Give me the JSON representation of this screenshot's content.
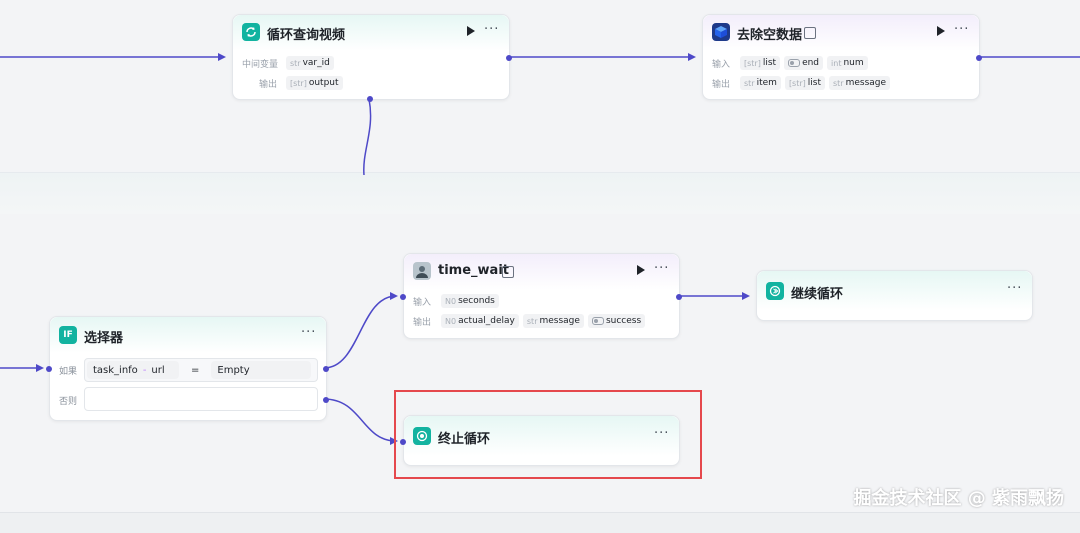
{
  "colors": {
    "accent": "#4e49c8",
    "teal": "#12b3a0",
    "highlight": "#e5484d"
  },
  "loop_query_node": {
    "title": "循环查询视频",
    "icon": "loop-icon",
    "middle_var_label": "中间变量",
    "middle_var": {
      "type": "str",
      "name": "var_id"
    },
    "output_label": "输出",
    "output": {
      "type": "[str]",
      "name": "output"
    }
  },
  "remove_empty_node": {
    "title": "去除空数据",
    "icon": "cube-icon",
    "input_label": "输入",
    "inputs": [
      {
        "type": "[str]",
        "name": "list"
      },
      {
        "type": "toggle",
        "name": "end"
      },
      {
        "type": "int",
        "name": "num"
      }
    ],
    "output_label": "输出",
    "outputs": [
      {
        "type": "str",
        "name": "item"
      },
      {
        "type": "[str]",
        "name": "list"
      },
      {
        "type": "str",
        "name": "message"
      }
    ]
  },
  "time_wait_node": {
    "title": "time_wait",
    "icon": "avatar-icon",
    "input_label": "输入",
    "inputs": [
      {
        "type": "N0",
        "name": "seconds"
      }
    ],
    "output_label": "输出",
    "outputs": [
      {
        "type": "N0",
        "name": "actual_delay"
      },
      {
        "type": "str",
        "name": "message"
      },
      {
        "type": "toggle",
        "name": "success"
      }
    ]
  },
  "continue_loop_node": {
    "title": "继续循环",
    "icon": "continue-icon"
  },
  "selector_node": {
    "title": "选择器",
    "icon": "if-icon",
    "icon_text": "IF",
    "if_label": "如果",
    "else_label": "否则",
    "condition": {
      "var": "task_info",
      "sep": "-",
      "field": "url",
      "op": "=",
      "value": "Empty"
    }
  },
  "terminate_loop_node": {
    "title": "终止循环",
    "icon": "stop-icon"
  },
  "more_glyph": "···",
  "watermark": "掘金技术社区 @ 紫雨飘扬"
}
